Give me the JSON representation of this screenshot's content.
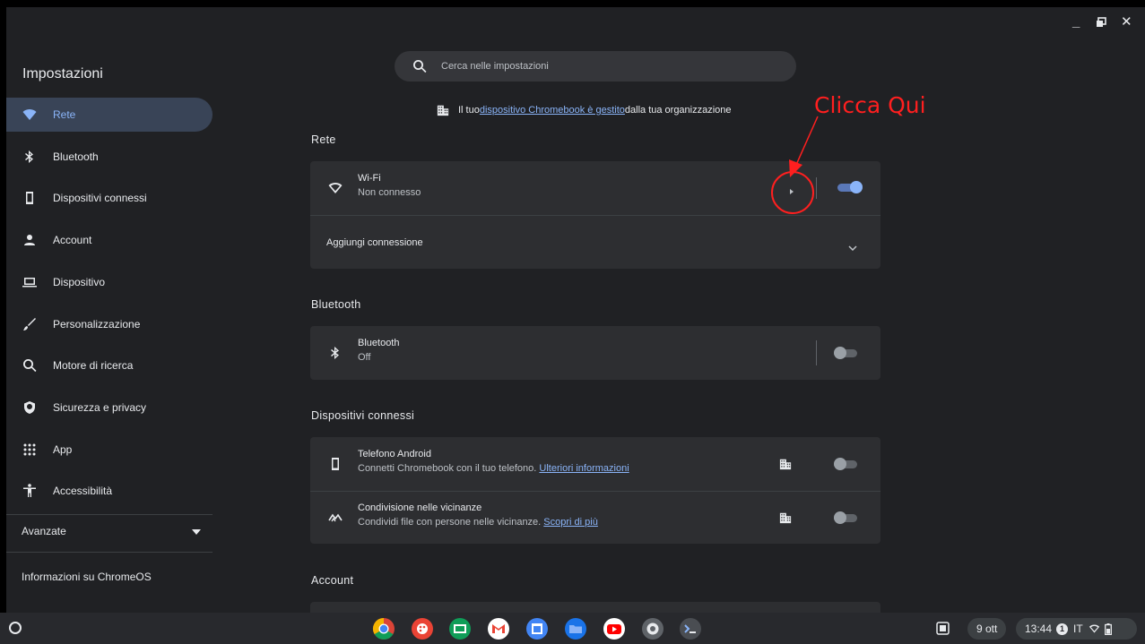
{
  "sidebar": {
    "title": "Impostazioni",
    "items": [
      {
        "label": "Rete",
        "icon": "wifi-icon",
        "active": true
      },
      {
        "label": "Bluetooth",
        "icon": "bluetooth-icon"
      },
      {
        "label": "Dispositivi connessi",
        "icon": "phone-icon"
      },
      {
        "label": "Account",
        "icon": "person-icon"
      },
      {
        "label": "Dispositivo",
        "icon": "laptop-icon"
      },
      {
        "label": "Personalizzazione",
        "icon": "brush-icon"
      },
      {
        "label": "Motore di ricerca",
        "icon": "search-icon"
      },
      {
        "label": "Sicurezza e privacy",
        "icon": "shield-icon"
      },
      {
        "label": "App",
        "icon": "apps-grid-icon"
      },
      {
        "label": "Accessibilità",
        "icon": "accessibility-icon"
      }
    ],
    "advanced_label": "Avanzate",
    "about_label": "Informazioni su ChromeOS"
  },
  "search": {
    "placeholder": "Cerca nelle impostazioni"
  },
  "managed": {
    "prefix": "Il tuo ",
    "link": "dispositivo Chromebook è gestito",
    "suffix": " dalla tua organizzazione"
  },
  "sections": {
    "rete": {
      "title": "Rete",
      "wifi_title": "Wi-Fi",
      "wifi_status": "Non connesso",
      "wifi_enabled": true,
      "add_connection": "Aggiungi connessione"
    },
    "bluetooth": {
      "title": "Bluetooth",
      "bt_title": "Bluetooth",
      "bt_status": "Off",
      "bt_enabled": false
    },
    "connected": {
      "title": "Dispositivi connessi",
      "phone_title": "Telefono Android",
      "phone_desc": "Connetti Chromebook con il tuo telefono. ",
      "phone_link": "Ulteriori informazioni",
      "nearby_title": "Condivisione nelle vicinanze",
      "nearby_desc": "Condividi file con persone nelle vicinanze. ",
      "nearby_link": "Scopri di più"
    },
    "account": {
      "title": "Account"
    }
  },
  "annotation": {
    "text": "Clicca Qui",
    "color": "#ff1f1f"
  },
  "shelf": {
    "apps": [
      "chrome-icon",
      "palette-icon",
      "classroom-icon",
      "gmail-icon",
      "calendar-icon",
      "files-icon",
      "youtube-icon",
      "settings-icon",
      "terminal-icon"
    ],
    "date": "9 ott",
    "time": "13:44",
    "notification_count": "1",
    "language": "IT"
  },
  "colors": {
    "accent": "#8ab4f8",
    "background": "#202124",
    "card": "#2d2e31"
  }
}
